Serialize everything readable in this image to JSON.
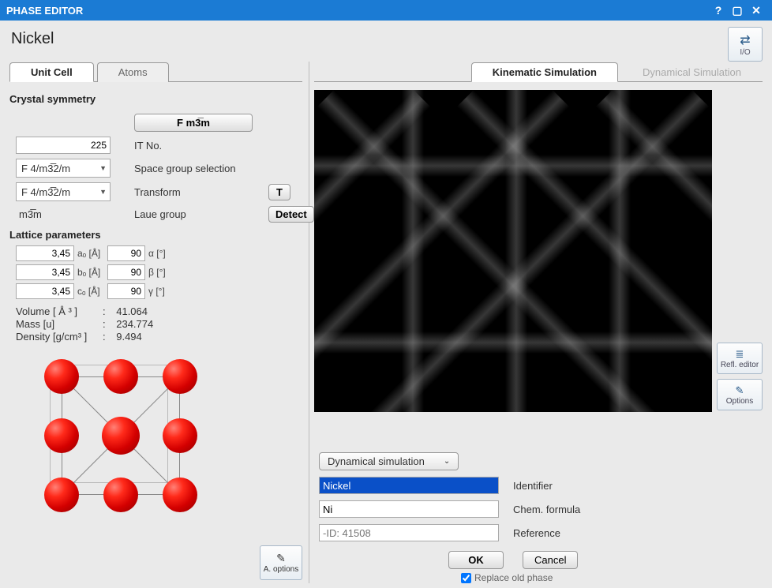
{
  "window": {
    "title": "PHASE EDITOR"
  },
  "phase_name": "Nickel",
  "io_label": "I/O",
  "left_tabs": {
    "t1": "Unit Cell",
    "t2": "Atoms"
  },
  "right_tabs": {
    "t1": "Kinematic Simulation",
    "t2": "Dynamical Simulation"
  },
  "symmetry": {
    "title": "Crystal symmetry",
    "group_btn": "F m3̅m",
    "it_no_value": "225",
    "it_no_label": "IT No.",
    "sel1": "F 4/m3̅2/m",
    "sel1_label": "Space group selection",
    "sel2": "F 4/m3̅2/m",
    "sel2_label": "Transform",
    "t_btn": "T",
    "laue_val": "m3̅m",
    "laue_label": "Laue group",
    "detect": "Detect"
  },
  "lattice": {
    "title": "Lattice parameters",
    "a_val": "3,45",
    "a_lbl": "aₒ [Å]",
    "alpha_val": "90",
    "alpha_lbl": "α [°]",
    "b_val": "3,45",
    "b_lbl": "bₒ [Å]",
    "beta_val": "90",
    "beta_lbl": "β [°]",
    "c_val": "3,45",
    "c_lbl": "cₒ [Å]",
    "gamma_val": "90",
    "gamma_lbl": "γ [°]"
  },
  "stats": {
    "vol_k": "Volume [ Å ³ ]",
    "vol_v": "41.064",
    "mass_k": "Mass [u]",
    "mass_v": "234.774",
    "den_k": "Density [g/cm³ ]",
    "den_v": "9.494"
  },
  "aopt": "A. options",
  "refl_editor": "Refl. editor",
  "options": "Options",
  "dyn_sim_btn": "Dynamical simulation",
  "form": {
    "id_val": "Nickel",
    "id_lbl": "Identifier",
    "chem_val": "Ni",
    "chem_lbl": "Chem. formula",
    "ref_ph": "-ID: 41508",
    "ref_lbl": "Reference"
  },
  "ok": "OK",
  "cancel": "Cancel",
  "replace": "Replace old phase"
}
